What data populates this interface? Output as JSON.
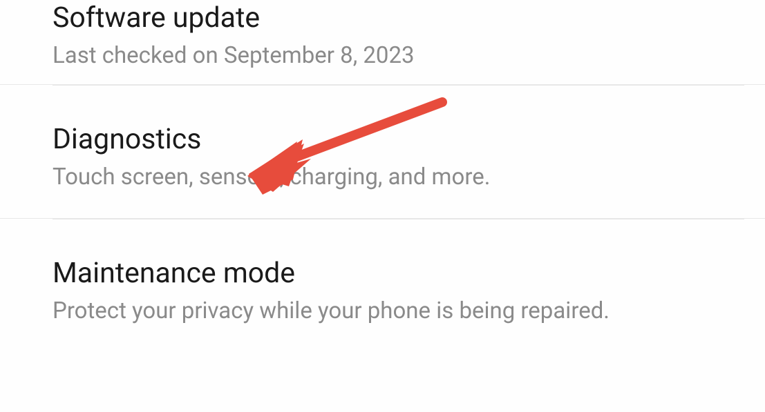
{
  "settings": {
    "items": [
      {
        "title": "Software update",
        "subtitle": "Last checked on September 8, 2023"
      },
      {
        "title": "Diagnostics",
        "subtitle": "Touch screen, sensors, charging, and more."
      },
      {
        "title": "Maintenance mode",
        "subtitle": "Protect your privacy while your phone is being repaired."
      }
    ]
  },
  "annotation": {
    "arrow_color": "#e74c3c"
  }
}
